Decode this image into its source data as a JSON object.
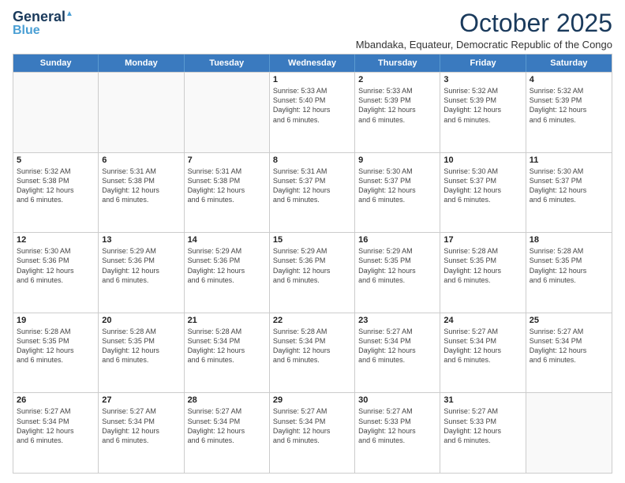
{
  "logo": {
    "line1": "General",
    "line2": "Blue"
  },
  "title": {
    "month": "October 2025",
    "location": "Mbandaka, Equateur, Democratic Republic of the Congo"
  },
  "header_days": [
    "Sunday",
    "Monday",
    "Tuesday",
    "Wednesday",
    "Thursday",
    "Friday",
    "Saturday"
  ],
  "weeks": [
    [
      {
        "day": "",
        "info": ""
      },
      {
        "day": "",
        "info": ""
      },
      {
        "day": "",
        "info": ""
      },
      {
        "day": "1",
        "info": "Sunrise: 5:33 AM\nSunset: 5:40 PM\nDaylight: 12 hours\nand 6 minutes."
      },
      {
        "day": "2",
        "info": "Sunrise: 5:33 AM\nSunset: 5:39 PM\nDaylight: 12 hours\nand 6 minutes."
      },
      {
        "day": "3",
        "info": "Sunrise: 5:32 AM\nSunset: 5:39 PM\nDaylight: 12 hours\nand 6 minutes."
      },
      {
        "day": "4",
        "info": "Sunrise: 5:32 AM\nSunset: 5:39 PM\nDaylight: 12 hours\nand 6 minutes."
      }
    ],
    [
      {
        "day": "5",
        "info": "Sunrise: 5:32 AM\nSunset: 5:38 PM\nDaylight: 12 hours\nand 6 minutes."
      },
      {
        "day": "6",
        "info": "Sunrise: 5:31 AM\nSunset: 5:38 PM\nDaylight: 12 hours\nand 6 minutes."
      },
      {
        "day": "7",
        "info": "Sunrise: 5:31 AM\nSunset: 5:38 PM\nDaylight: 12 hours\nand 6 minutes."
      },
      {
        "day": "8",
        "info": "Sunrise: 5:31 AM\nSunset: 5:37 PM\nDaylight: 12 hours\nand 6 minutes."
      },
      {
        "day": "9",
        "info": "Sunrise: 5:30 AM\nSunset: 5:37 PM\nDaylight: 12 hours\nand 6 minutes."
      },
      {
        "day": "10",
        "info": "Sunrise: 5:30 AM\nSunset: 5:37 PM\nDaylight: 12 hours\nand 6 minutes."
      },
      {
        "day": "11",
        "info": "Sunrise: 5:30 AM\nSunset: 5:37 PM\nDaylight: 12 hours\nand 6 minutes."
      }
    ],
    [
      {
        "day": "12",
        "info": "Sunrise: 5:30 AM\nSunset: 5:36 PM\nDaylight: 12 hours\nand 6 minutes."
      },
      {
        "day": "13",
        "info": "Sunrise: 5:29 AM\nSunset: 5:36 PM\nDaylight: 12 hours\nand 6 minutes."
      },
      {
        "day": "14",
        "info": "Sunrise: 5:29 AM\nSunset: 5:36 PM\nDaylight: 12 hours\nand 6 minutes."
      },
      {
        "day": "15",
        "info": "Sunrise: 5:29 AM\nSunset: 5:36 PM\nDaylight: 12 hours\nand 6 minutes."
      },
      {
        "day": "16",
        "info": "Sunrise: 5:29 AM\nSunset: 5:35 PM\nDaylight: 12 hours\nand 6 minutes."
      },
      {
        "day": "17",
        "info": "Sunrise: 5:28 AM\nSunset: 5:35 PM\nDaylight: 12 hours\nand 6 minutes."
      },
      {
        "day": "18",
        "info": "Sunrise: 5:28 AM\nSunset: 5:35 PM\nDaylight: 12 hours\nand 6 minutes."
      }
    ],
    [
      {
        "day": "19",
        "info": "Sunrise: 5:28 AM\nSunset: 5:35 PM\nDaylight: 12 hours\nand 6 minutes."
      },
      {
        "day": "20",
        "info": "Sunrise: 5:28 AM\nSunset: 5:35 PM\nDaylight: 12 hours\nand 6 minutes."
      },
      {
        "day": "21",
        "info": "Sunrise: 5:28 AM\nSunset: 5:34 PM\nDaylight: 12 hours\nand 6 minutes."
      },
      {
        "day": "22",
        "info": "Sunrise: 5:28 AM\nSunset: 5:34 PM\nDaylight: 12 hours\nand 6 minutes."
      },
      {
        "day": "23",
        "info": "Sunrise: 5:27 AM\nSunset: 5:34 PM\nDaylight: 12 hours\nand 6 minutes."
      },
      {
        "day": "24",
        "info": "Sunrise: 5:27 AM\nSunset: 5:34 PM\nDaylight: 12 hours\nand 6 minutes."
      },
      {
        "day": "25",
        "info": "Sunrise: 5:27 AM\nSunset: 5:34 PM\nDaylight: 12 hours\nand 6 minutes."
      }
    ],
    [
      {
        "day": "26",
        "info": "Sunrise: 5:27 AM\nSunset: 5:34 PM\nDaylight: 12 hours\nand 6 minutes."
      },
      {
        "day": "27",
        "info": "Sunrise: 5:27 AM\nSunset: 5:34 PM\nDaylight: 12 hours\nand 6 minutes."
      },
      {
        "day": "28",
        "info": "Sunrise: 5:27 AM\nSunset: 5:34 PM\nDaylight: 12 hours\nand 6 minutes."
      },
      {
        "day": "29",
        "info": "Sunrise: 5:27 AM\nSunset: 5:34 PM\nDaylight: 12 hours\nand 6 minutes."
      },
      {
        "day": "30",
        "info": "Sunrise: 5:27 AM\nSunset: 5:33 PM\nDaylight: 12 hours\nand 6 minutes."
      },
      {
        "day": "31",
        "info": "Sunrise: 5:27 AM\nSunset: 5:33 PM\nDaylight: 12 hours\nand 6 minutes."
      },
      {
        "day": "",
        "info": ""
      }
    ]
  ]
}
